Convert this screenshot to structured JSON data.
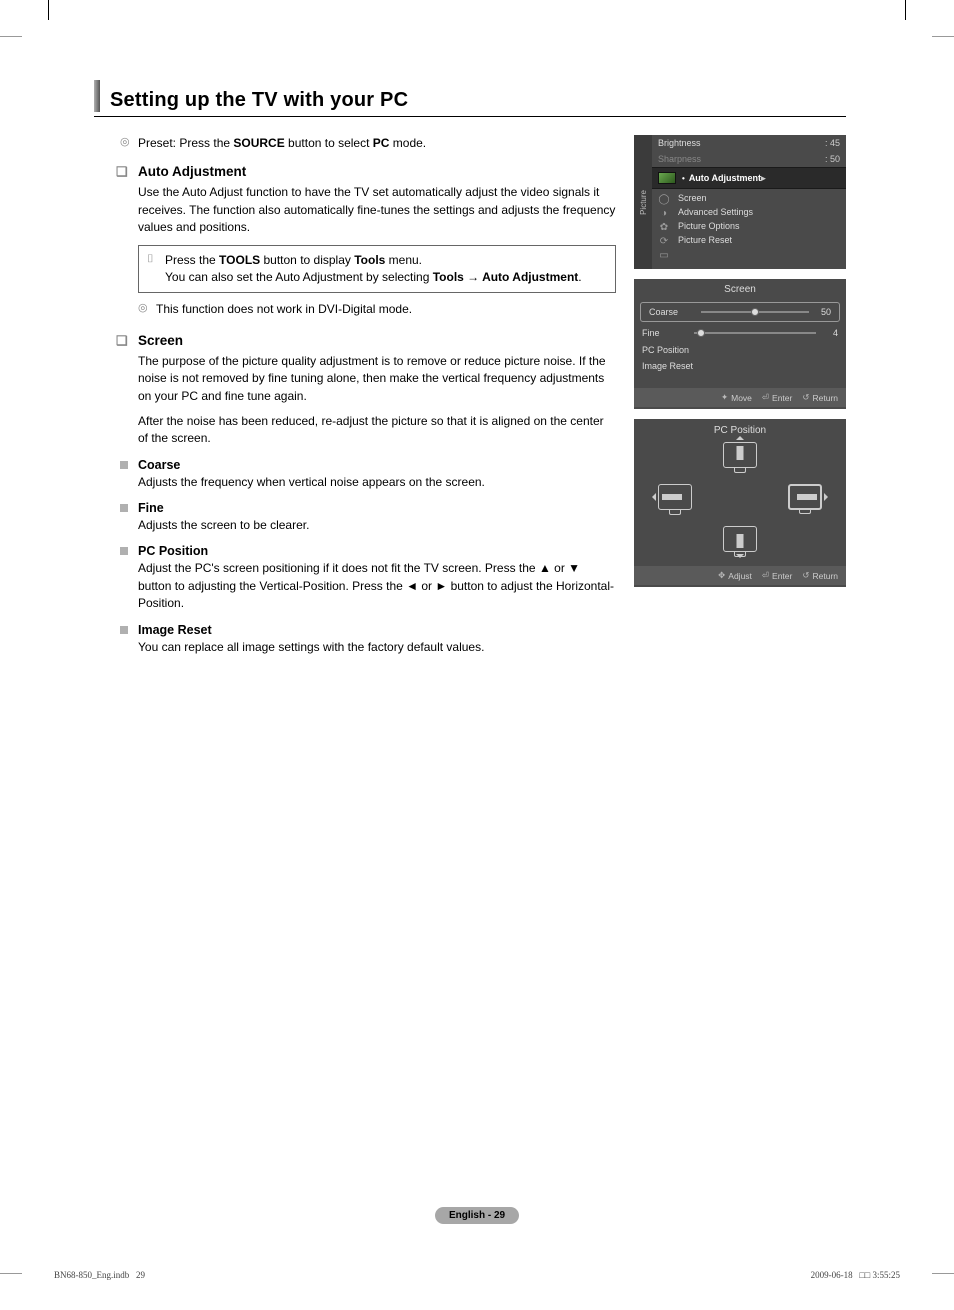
{
  "section_title": "Setting up the TV with your PC",
  "preset_line_pre": "Preset: Press the ",
  "preset_source": "SOURCE",
  "preset_mid": " button to select ",
  "preset_pc": "PC",
  "preset_end": " mode.",
  "auto_adj_heading": "Auto Adjustment",
  "auto_adj_body": "Use the Auto Adjust function to have the TV set automatically adjust the video signals it receives. The function also automatically fine-tunes the settings and adjusts the frequency values and positions.",
  "tip_line1_pre": "Press the ",
  "tip_tools": "TOOLS",
  "tip_line1_mid": " button to display ",
  "tip_tools2": "Tools",
  "tip_line1_end": " menu.",
  "tip_line2_pre": "You can also set the Auto Adjustment by selecting ",
  "tip_path": "Tools → Auto Adjustment",
  "tip_line2_end": ".",
  "dvi_note": "This function does not work in DVI-Digital mode.",
  "screen_heading": "Screen",
  "screen_body1": "The purpose of the picture quality adjustment is to remove or reduce picture noise. If the noise is not removed by fine tuning alone, then make the vertical frequency adjustments on your PC and fine tune again.",
  "screen_body2": "After the noise has been reduced, re-adjust the picture so that it is aligned on the center of the screen.",
  "coarse_heading": "Coarse",
  "coarse_body": "Adjusts the frequency when vertical noise appears on the screen.",
  "fine_heading": "Fine",
  "fine_body": "Adjusts the screen to be clearer.",
  "pcpos_heading": "PC Position",
  "pcpos_body": "Adjust the PC's screen positioning if it does not fit the TV screen. Press the ▲ or ▼ button to adjusting the Vertical-Position. Press the ◄ or ► button to adjust the Horizontal-Position.",
  "imgreset_heading": "Image Reset",
  "imgreset_body": "You can replace all image settings with the factory default values.",
  "osd1": {
    "side_tab": "Picture",
    "brightness_label": "Brightness",
    "brightness_value": ": 45",
    "sharpness_label": "Sharpness",
    "sharpness_value": ": 50",
    "highlight": "Auto Adjustment",
    "items": [
      "Screen",
      "Advanced Settings",
      "Picture Options",
      "Picture Reset"
    ]
  },
  "osd2": {
    "title": "Screen",
    "coarse_label": "Coarse",
    "coarse_value": "50",
    "fine_label": "Fine",
    "fine_value": "4",
    "pcpos": "PC Position",
    "imgreset": "Image Reset",
    "footer_move": "Move",
    "footer_enter": "Enter",
    "footer_return": "Return"
  },
  "osd3": {
    "title": "PC Position",
    "footer_adjust": "Adjust",
    "footer_enter": "Enter",
    "footer_return": "Return"
  },
  "page_pill": "English - 29",
  "print_left_a": "BN68-850_Eng.indb",
  "print_left_b": "29",
  "print_right_a": "2009-06-18",
  "print_right_b": "□□ 3:55:25"
}
